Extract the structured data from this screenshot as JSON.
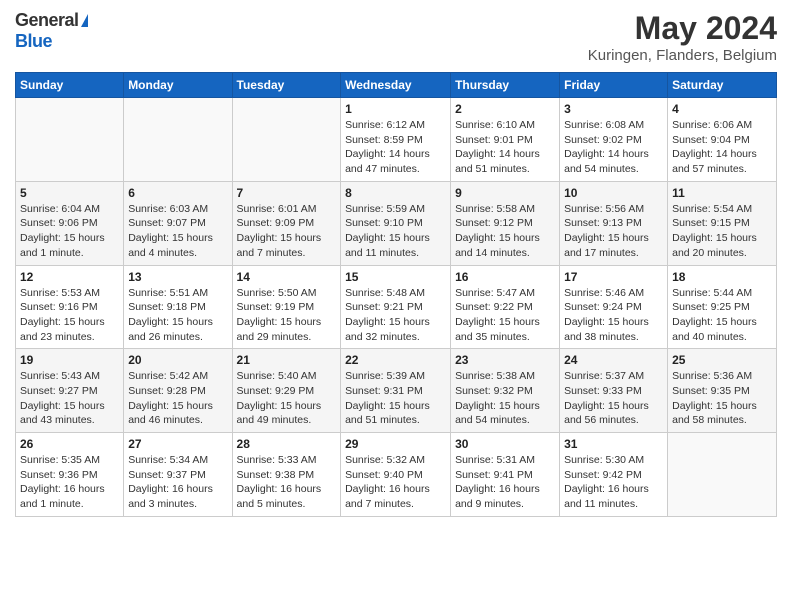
{
  "header": {
    "logo_general": "General",
    "logo_blue": "Blue",
    "title": "May 2024",
    "subtitle": "Kuringen, Flanders, Belgium"
  },
  "days_of_week": [
    "Sunday",
    "Monday",
    "Tuesday",
    "Wednesday",
    "Thursday",
    "Friday",
    "Saturday"
  ],
  "weeks": [
    [
      {
        "day": "",
        "info": ""
      },
      {
        "day": "",
        "info": ""
      },
      {
        "day": "",
        "info": ""
      },
      {
        "day": "1",
        "info": "Sunrise: 6:12 AM\nSunset: 8:59 PM\nDaylight: 14 hours\nand 47 minutes."
      },
      {
        "day": "2",
        "info": "Sunrise: 6:10 AM\nSunset: 9:01 PM\nDaylight: 14 hours\nand 51 minutes."
      },
      {
        "day": "3",
        "info": "Sunrise: 6:08 AM\nSunset: 9:02 PM\nDaylight: 14 hours\nand 54 minutes."
      },
      {
        "day": "4",
        "info": "Sunrise: 6:06 AM\nSunset: 9:04 PM\nDaylight: 14 hours\nand 57 minutes."
      }
    ],
    [
      {
        "day": "5",
        "info": "Sunrise: 6:04 AM\nSunset: 9:06 PM\nDaylight: 15 hours\nand 1 minute."
      },
      {
        "day": "6",
        "info": "Sunrise: 6:03 AM\nSunset: 9:07 PM\nDaylight: 15 hours\nand 4 minutes."
      },
      {
        "day": "7",
        "info": "Sunrise: 6:01 AM\nSunset: 9:09 PM\nDaylight: 15 hours\nand 7 minutes."
      },
      {
        "day": "8",
        "info": "Sunrise: 5:59 AM\nSunset: 9:10 PM\nDaylight: 15 hours\nand 11 minutes."
      },
      {
        "day": "9",
        "info": "Sunrise: 5:58 AM\nSunset: 9:12 PM\nDaylight: 15 hours\nand 14 minutes."
      },
      {
        "day": "10",
        "info": "Sunrise: 5:56 AM\nSunset: 9:13 PM\nDaylight: 15 hours\nand 17 minutes."
      },
      {
        "day": "11",
        "info": "Sunrise: 5:54 AM\nSunset: 9:15 PM\nDaylight: 15 hours\nand 20 minutes."
      }
    ],
    [
      {
        "day": "12",
        "info": "Sunrise: 5:53 AM\nSunset: 9:16 PM\nDaylight: 15 hours\nand 23 minutes."
      },
      {
        "day": "13",
        "info": "Sunrise: 5:51 AM\nSunset: 9:18 PM\nDaylight: 15 hours\nand 26 minutes."
      },
      {
        "day": "14",
        "info": "Sunrise: 5:50 AM\nSunset: 9:19 PM\nDaylight: 15 hours\nand 29 minutes."
      },
      {
        "day": "15",
        "info": "Sunrise: 5:48 AM\nSunset: 9:21 PM\nDaylight: 15 hours\nand 32 minutes."
      },
      {
        "day": "16",
        "info": "Sunrise: 5:47 AM\nSunset: 9:22 PM\nDaylight: 15 hours\nand 35 minutes."
      },
      {
        "day": "17",
        "info": "Sunrise: 5:46 AM\nSunset: 9:24 PM\nDaylight: 15 hours\nand 38 minutes."
      },
      {
        "day": "18",
        "info": "Sunrise: 5:44 AM\nSunset: 9:25 PM\nDaylight: 15 hours\nand 40 minutes."
      }
    ],
    [
      {
        "day": "19",
        "info": "Sunrise: 5:43 AM\nSunset: 9:27 PM\nDaylight: 15 hours\nand 43 minutes."
      },
      {
        "day": "20",
        "info": "Sunrise: 5:42 AM\nSunset: 9:28 PM\nDaylight: 15 hours\nand 46 minutes."
      },
      {
        "day": "21",
        "info": "Sunrise: 5:40 AM\nSunset: 9:29 PM\nDaylight: 15 hours\nand 49 minutes."
      },
      {
        "day": "22",
        "info": "Sunrise: 5:39 AM\nSunset: 9:31 PM\nDaylight: 15 hours\nand 51 minutes."
      },
      {
        "day": "23",
        "info": "Sunrise: 5:38 AM\nSunset: 9:32 PM\nDaylight: 15 hours\nand 54 minutes."
      },
      {
        "day": "24",
        "info": "Sunrise: 5:37 AM\nSunset: 9:33 PM\nDaylight: 15 hours\nand 56 minutes."
      },
      {
        "day": "25",
        "info": "Sunrise: 5:36 AM\nSunset: 9:35 PM\nDaylight: 15 hours\nand 58 minutes."
      }
    ],
    [
      {
        "day": "26",
        "info": "Sunrise: 5:35 AM\nSunset: 9:36 PM\nDaylight: 16 hours\nand 1 minute."
      },
      {
        "day": "27",
        "info": "Sunrise: 5:34 AM\nSunset: 9:37 PM\nDaylight: 16 hours\nand 3 minutes."
      },
      {
        "day": "28",
        "info": "Sunrise: 5:33 AM\nSunset: 9:38 PM\nDaylight: 16 hours\nand 5 minutes."
      },
      {
        "day": "29",
        "info": "Sunrise: 5:32 AM\nSunset: 9:40 PM\nDaylight: 16 hours\nand 7 minutes."
      },
      {
        "day": "30",
        "info": "Sunrise: 5:31 AM\nSunset: 9:41 PM\nDaylight: 16 hours\nand 9 minutes."
      },
      {
        "day": "31",
        "info": "Sunrise: 5:30 AM\nSunset: 9:42 PM\nDaylight: 16 hours\nand 11 minutes."
      },
      {
        "day": "",
        "info": ""
      }
    ]
  ]
}
